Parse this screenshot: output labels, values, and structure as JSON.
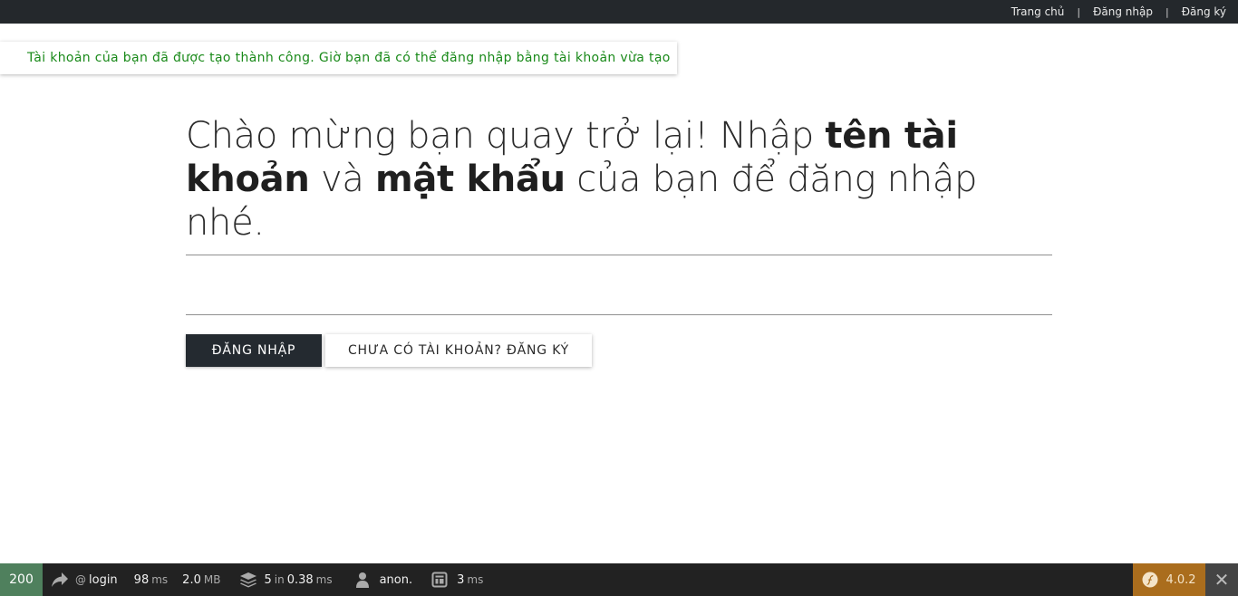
{
  "nav": {
    "home": "Trang chủ",
    "login": "Đăng nhập",
    "register": "Đăng ký",
    "separator": "|"
  },
  "flash": {
    "message": "Tài khoản của bạn đã được tạo thành công. Giờ bạn đã có thể đăng nhập bằng tài khoản vừa tạo",
    "color": "#1a8a1a"
  },
  "heading": {
    "part1": "Chào mừng bạn quay trở lại! Nhập ",
    "bold1": "tên tài khoản",
    "part2": " và ",
    "bold2": "mật khẩu",
    "part3": " của bạn để đăng nhập nhé."
  },
  "form": {
    "username": {
      "value": "",
      "placeholder": ""
    },
    "password": {
      "value": "",
      "placeholder": ""
    },
    "login_label": "ĐĂNG NHẬP",
    "register_label": "CHƯA CÓ TÀI KHOẢN? ĐĂNG KÝ"
  },
  "toolbar": {
    "status_code": "200",
    "route_at": "@",
    "route": "login",
    "time_value": "98",
    "time_unit": "ms",
    "memory_value": "2.0",
    "memory_unit": "MB",
    "db_count": "5",
    "db_in": "in",
    "db_time": "0.38",
    "db_unit": "ms",
    "user": "anon.",
    "twig_value": "3",
    "twig_unit": "ms",
    "version": "4.0.2",
    "close_label": "✕",
    "icons": [
      "route-arrow-icon",
      "database-layers-icon",
      "user-icon",
      "twig-template-icon",
      "symfony-logo-icon",
      "close-icon"
    ],
    "status_color": "#4f805d",
    "version_color": "#aa6d1d"
  }
}
